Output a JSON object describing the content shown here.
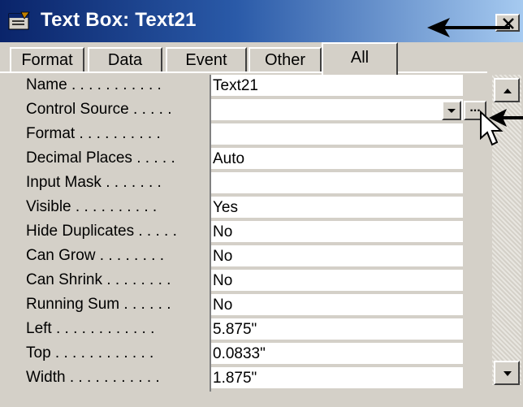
{
  "window": {
    "title": "Text Box: Text21"
  },
  "tabs": [
    {
      "label": "Format"
    },
    {
      "label": "Data"
    },
    {
      "label": "Event"
    },
    {
      "label": "Other"
    },
    {
      "label": "All",
      "active": true
    }
  ],
  "properties": [
    {
      "label": "Name . . . . . . . . . . .",
      "value": "Text21"
    },
    {
      "label": "Control Source . . . . .",
      "value": ""
    },
    {
      "label": "Format . . . . . . . . . .",
      "value": ""
    },
    {
      "label": "Decimal Places . . . . .",
      "value": "Auto"
    },
    {
      "label": "Input Mask . . . . . . .",
      "value": ""
    },
    {
      "label": "Visible . . . . . . . . . .",
      "value": "Yes"
    },
    {
      "label": "Hide Duplicates . . . . .",
      "value": "No"
    },
    {
      "label": "Can Grow . . . . . . . .",
      "value": "No"
    },
    {
      "label": "Can Shrink . . . . . . . .",
      "value": "No"
    },
    {
      "label": "Running Sum . . . . . .",
      "value": "No"
    },
    {
      "label": "Left . . . . . . . . . . . .",
      "value": "5.875\""
    },
    {
      "label": "Top . . . . . . . . . . . .",
      "value": "0.0833\""
    },
    {
      "label": "Width . . . . . . . . . . .",
      "value": "1.875\""
    }
  ],
  "builder_button": {
    "label": "..."
  },
  "colors": {
    "titlebar_start": "#0a246a",
    "titlebar_end": "#a6caf0",
    "face": "#d4d0c8"
  },
  "icons": [
    "properties-window-icon",
    "close-icon",
    "dropdown-arrow-icon",
    "scroll-up-icon",
    "scroll-down-icon",
    "mouse-pointer-icon",
    "annotation-arrow-icon"
  ]
}
